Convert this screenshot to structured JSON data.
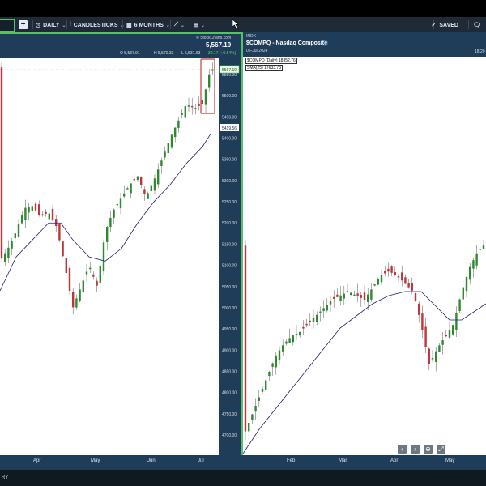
{
  "toolbar": {
    "period": "DAILY",
    "chart_type": "CANDLESTICKS",
    "range": "6 MONTHS",
    "saved": "SAVED"
  },
  "left_chart": {
    "watermark": "© StockCharts.com",
    "last_price": "5,567.19",
    "ohlc": {
      "open": "O 5,537.91",
      "high": "H 5,570.33",
      "low": "L 5,531.63",
      "change": "+30.17 (+0.54%)"
    },
    "price_tag": "5567.19",
    "sma_tag": "5419.56",
    "y_ticks": [
      "5550.00",
      "5500.00",
      "5450.00",
      "5400.00",
      "5350.00",
      "5300.00",
      "5250.00",
      "5200.00",
      "5150.00",
      "5100.00",
      "5050.00",
      "5000.00",
      "4950.00",
      "4900.00",
      "4850.00",
      "4800.00",
      "4750.00",
      "4700.00"
    ],
    "x_labels": [
      "Apr",
      "May",
      "Jun",
      "Jul"
    ]
  },
  "right_chart": {
    "exchange": "INDX",
    "title": "$COMPQ - Nasdaq Composite",
    "date": "05-Jul-2024",
    "right_value": "18,20",
    "legend_price": "$COMPQ (Daily) 18352.76",
    "legend_sma": "SMA(25) 17633.73",
    "x_labels": [
      "Feb",
      "Mar",
      "Apr",
      "May"
    ]
  },
  "bottom": {
    "label": "RY"
  },
  "colors": {
    "up": "#2e8a2e",
    "down": "#c2333b",
    "sma": "#1c1f6e",
    "panel": "#1f3c58",
    "accent": "#56c168"
  }
}
